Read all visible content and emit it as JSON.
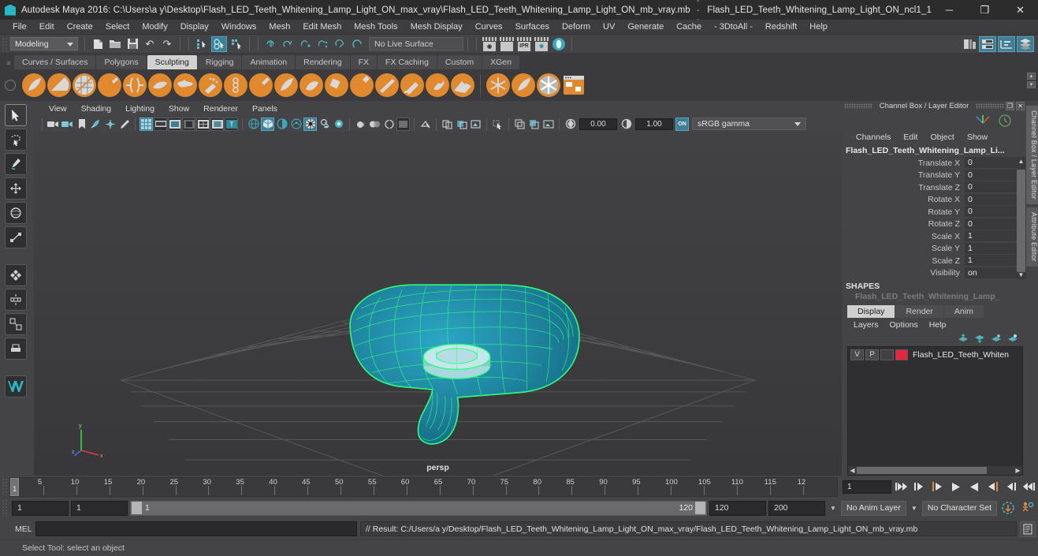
{
  "titlebar": {
    "app_title": "Autodesk Maya 2016: C:\\Users\\a y\\Desktop\\Flash_LED_Teeth_Whitening_Lamp_Light_ON_max_vray\\Flash_LED_Teeth_Whitening_Lamp_Light_ON_mb_vray.mb",
    "separator": "---",
    "object_name": "Flash_LED_Teeth_Whitening_Lamp_Light_ON_ncl1_1",
    "minimize": "─",
    "maximize": "❐",
    "close": "✕"
  },
  "menubar": {
    "items": [
      "File",
      "Edit",
      "Create",
      "Select",
      "Modify",
      "Display",
      "Windows",
      "Mesh",
      "Edit Mesh",
      "Mesh Tools",
      "Mesh Display",
      "Curves",
      "Surfaces",
      "Deform",
      "UV",
      "Generate",
      "Cache",
      "- 3DtoAll -",
      "Redshift",
      "Help"
    ]
  },
  "statusbar": {
    "mode": "Modeling",
    "live_surface": "No Live Surface",
    "file_icons": [
      "new-scene-icon",
      "open-scene-icon",
      "save-scene-icon",
      "undo-icon",
      "redo-icon"
    ],
    "select_mode_icons": [
      "select-hierarchy-icon",
      "select-object-icon",
      "select-component-icon"
    ],
    "snap_icons": [
      "snap-grid-icon",
      "snap-curve-icon",
      "snap-point-icon",
      "snap-projected-icon",
      "snap-view-plane-icon",
      "snap-arc-icon"
    ],
    "render_icons": [
      "render-current-frame-icon",
      "render-sequence-icon",
      "ipr-render-icon",
      "render-settings-icon",
      "hypershade-icon"
    ],
    "editor_icons": [
      "show-hide-hypergraph-icon",
      "show-hide-outliner-icon",
      "show-hide-graph-editor-icon",
      "show-hide-layer-editor-icon"
    ],
    "ipr_label": "IPR"
  },
  "shelf": {
    "tabs": [
      "Curves / Surfaces",
      "Polygons",
      "Sculpting",
      "Rigging",
      "Animation",
      "Rendering",
      "FX",
      "FX Caching",
      "Custom",
      "XGen"
    ],
    "active_tab": "Sculpting",
    "icons": [
      "sculpt-tool-icon",
      "smooth-tool-icon",
      "relax-tool-icon",
      "grab-tool-icon",
      "pinch-tool-icon",
      "flatten-tool-icon",
      "foamy-tool-icon",
      "spray-tool-icon",
      "repeat-tool-icon",
      "imprint-tool-icon",
      "wax-tool-icon",
      "scrape-tool-icon",
      "fill-tool-icon",
      "knife-tool-icon",
      "smear-tool-icon",
      "bulge-tool-icon",
      "amplify-tool-icon",
      "freeze-tool-icon",
      "freeze-all-icon",
      "sculpt-settings-icon",
      "mirror-sculpt-icon",
      "clone-target-icon"
    ]
  },
  "viewport": {
    "menus": [
      "View",
      "Shading",
      "Lighting",
      "Show",
      "Renderer",
      "Panels"
    ],
    "camera_label": "persp",
    "exposure_value": "0.00",
    "gamma_value": "1.00",
    "color_space": "sRGB gamma",
    "gamma_toggle": "ON",
    "toolbar_icons": [
      "select-camera-icon",
      "camera-attributes-icon",
      "bookmark-icon",
      "image-plane-icon",
      "two-d-pan-zoom-icon",
      "grease-pencil-icon",
      "grid-toggle-icon",
      "film-gate-icon",
      "resolution-gate-icon",
      "gate-mask-icon",
      "field-chart-icon",
      "safe-action-icon",
      "safe-title-icon",
      "wireframe-shading-icon",
      "smooth-shade-all-icon",
      "shaded-wireframe-icon",
      "textured-shading-icon",
      "lighting-icon",
      "shadows-icon",
      "screen-space-ao-icon",
      "motion-blur-icon",
      "multisample-icon",
      "depth-of-field-icon",
      "isolate-select-icon",
      "xray-icon",
      "xray-joints-icon",
      "xray-active-components-icon",
      "exposure-icon"
    ]
  },
  "toolbox": {
    "tools": [
      "select-tool-icon",
      "lasso-select-tool-icon",
      "paint-select-tool-icon",
      "move-tool-icon",
      "rotate-tool-icon",
      "scale-tool-icon",
      "last-tool-icon",
      "universal-manip-icon",
      "soft-modification-icon",
      "show-manip-icon",
      "maya-logo-icon"
    ]
  },
  "channel_box": {
    "panel_title": "Channel Box / Layer Editor",
    "undock_icon": "undock-icon",
    "close_icon": "close-icon",
    "menus": [
      "Channels",
      "Edit",
      "Object",
      "Show"
    ],
    "object_name": "Flash_LED_Teeth_Whitening_Lamp_Li...",
    "attributes": [
      {
        "label": "Translate X",
        "value": "0"
      },
      {
        "label": "Translate Y",
        "value": "0"
      },
      {
        "label": "Translate Z",
        "value": "0"
      },
      {
        "label": "Rotate X",
        "value": "0"
      },
      {
        "label": "Rotate Y",
        "value": "0"
      },
      {
        "label": "Rotate Z",
        "value": "0"
      },
      {
        "label": "Scale X",
        "value": "1"
      },
      {
        "label": "Scale Y",
        "value": "1"
      },
      {
        "label": "Scale Z",
        "value": "1"
      },
      {
        "label": "Visibility",
        "value": "on"
      }
    ],
    "shapes_header": "SHAPES",
    "shape_name": "Flash_LED_Teeth_Whitening_Lamp_"
  },
  "side_tabs": [
    "Channel Box / Layer Editor",
    "Attribute Editor"
  ],
  "layer_editor": {
    "tabs": [
      "Display",
      "Render",
      "Anim"
    ],
    "active_tab": "Display",
    "menus": [
      "Layers",
      "Options",
      "Help"
    ],
    "buttons": [
      "move-layer-up-icon",
      "move-layer-down-icon",
      "new-layer-icon",
      "new-layer-from-selected-icon"
    ],
    "layers": [
      {
        "visibility": "V",
        "playback": "P",
        "type": "",
        "color": "#e8253a",
        "name": "Flash_LED_Teeth_Whiten"
      }
    ]
  },
  "timeline": {
    "ticks": [
      "5",
      "10",
      "15",
      "20",
      "25",
      "30",
      "35",
      "40",
      "45",
      "50",
      "55",
      "60",
      "65",
      "70",
      "75",
      "80",
      "85",
      "90",
      "95",
      "100",
      "105",
      "110",
      "115",
      "12"
    ],
    "current_frame": "1",
    "current_frame_field": "1",
    "playback_buttons": [
      "go-to-start-icon",
      "step-back-keyframe-icon",
      "step-back-frame-icon",
      "play-backwards-icon",
      "play-forwards-icon",
      "step-forward-frame-icon",
      "step-forward-keyframe-icon",
      "go-to-end-icon"
    ]
  },
  "range_slider": {
    "anim_start": "1",
    "range_start": "1",
    "slider_start_label": "1",
    "slider_end_label": "120",
    "range_end": "120",
    "anim_end": "200",
    "anim_layer": "No Anim Layer",
    "character_set": "No Character Set",
    "auto_key_icon": "auto-keyframe-icon",
    "anim_prefs_icon": "animation-preferences-icon"
  },
  "command_line": {
    "language_label": "MEL",
    "input_value": "",
    "result_text": "// Result: C:/Users/a y/Desktop/Flash_LED_Teeth_Whitening_Lamp_Light_ON_max_vray/Flash_LED_Teeth_Whitening_Lamp_Light_ON_mb_vray.mb",
    "script_editor_icon": "script-editor-icon"
  },
  "help_line": {
    "text": "Select Tool: select an object"
  },
  "colors": {
    "accent_teal": "#4fb3bf",
    "shelf_orange": "#e0892f",
    "selection_green": "#2aff7d",
    "mesh_teal": "#1f8fa8",
    "layer_red": "#e8253a",
    "active_blue": "#3f7f96"
  }
}
